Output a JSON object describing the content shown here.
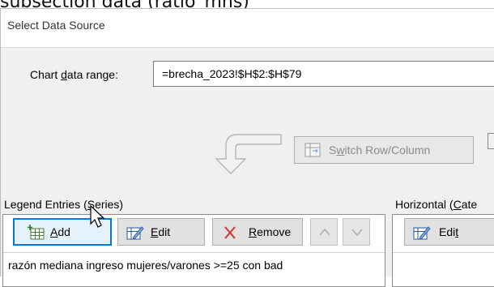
{
  "background": {
    "partial_heading": "subsection data (ratio_mhs)"
  },
  "dialog": {
    "title": "Select Data Source",
    "range_label_pre": "Chart ",
    "range_label_ul": "d",
    "range_label_post": "ata range:",
    "range_value": "=brecha_2023!$H$2:$H$79",
    "switch_pre": "S",
    "switch_ul": "w",
    "switch_post": "itch Row/Column"
  },
  "legend": {
    "label_pre": "Legend Entries (",
    "label_ul": "S",
    "label_post": "eries)",
    "add_pre": "",
    "add_ul": "A",
    "add_post": "dd",
    "edit_pre": "",
    "edit_ul": "E",
    "edit_post": "dit",
    "remove_pre": "",
    "remove_ul": "R",
    "remove_post": "emove",
    "series": [
      "razón mediana ingreso mujeres/varones >=25 con bad"
    ]
  },
  "horizontal": {
    "label_pre": "Horizontal (",
    "label_ul": "C",
    "label_post": "ate",
    "edit_pre": "Edi",
    "edit_ul": "t",
    "edit_post": ""
  },
  "icons": [
    "switch-row-column-icon",
    "add-icon",
    "edit-icon",
    "remove-icon",
    "move-up-icon",
    "move-down-icon",
    "curved-arrow-icon",
    "mouse-cursor-icon"
  ],
  "colors": {
    "accent": "#0078d7",
    "remove_x": "#d13438",
    "disabled_text": "#8a8a8a"
  }
}
